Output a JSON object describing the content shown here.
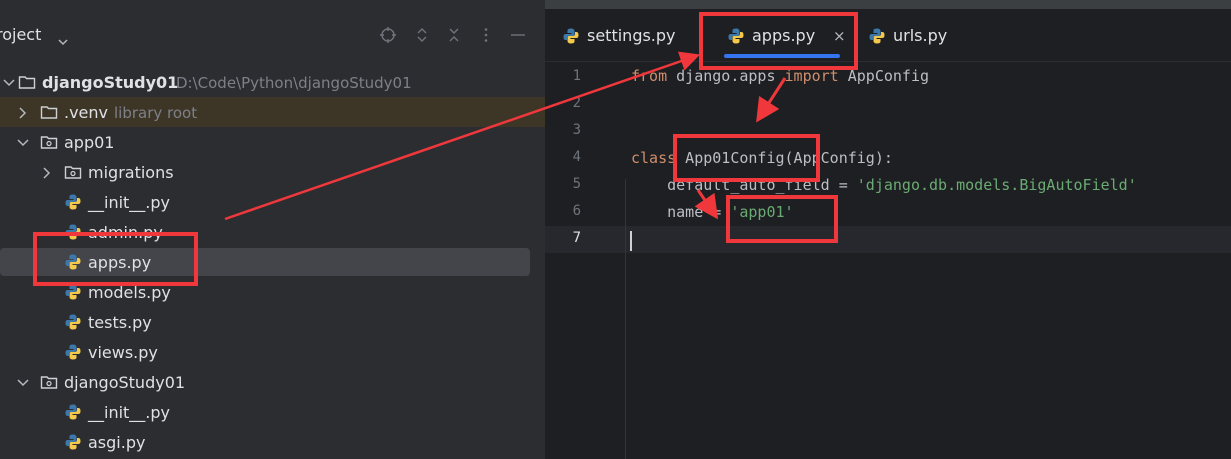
{
  "project_panel": {
    "title": "roject",
    "tree": [
      {
        "label": "djangoStudy01",
        "hint": "D:\\Code\\Python\\djangoStudy01"
      },
      {
        "label": ".venv",
        "hint": "library root"
      },
      {
        "label": "app01"
      },
      {
        "label": "migrations"
      },
      {
        "label": "__init__.py"
      },
      {
        "label": "admin.py"
      },
      {
        "label": "apps.py"
      },
      {
        "label": "models.py"
      },
      {
        "label": "tests.py"
      },
      {
        "label": "views.py"
      },
      {
        "label": "djangoStudy01"
      },
      {
        "label": "__init__.py"
      },
      {
        "label": "asgi.py"
      }
    ]
  },
  "editor": {
    "tabs": [
      {
        "label": "settings.py"
      },
      {
        "label": "apps.py",
        "active": true
      },
      {
        "label": "urls.py"
      }
    ],
    "tab_close": "×",
    "line_numbers": [
      "1",
      "2",
      "3",
      "4",
      "5",
      "6",
      "7"
    ],
    "code": {
      "l1": {
        "kw1": "from",
        "mod": " django.apps ",
        "kw2": "import",
        "name": " AppConfig"
      },
      "l4": {
        "kw": "class",
        "name": " App01Config(AppConfig):"
      },
      "l5": {
        "lead": "    default_auto_field = ",
        "str": "'django.db.models.BigAutoField'"
      },
      "l6": {
        "lead": "    name = ",
        "str": "'app01'"
      }
    }
  },
  "colors": {
    "annotation_red": "#f0383c",
    "accent_blue": "#3574f0",
    "keyword": "#cf8e6d",
    "string": "#6aab73"
  }
}
